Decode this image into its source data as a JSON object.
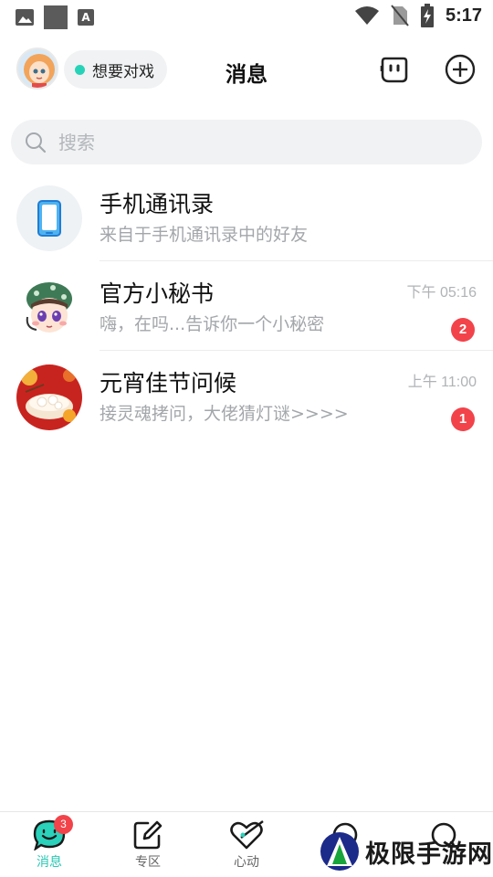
{
  "status_bar": {
    "time": "5:17"
  },
  "header": {
    "status_text": "想要对戏",
    "title": "消息",
    "colors": {
      "status_dot": "#27d3b8"
    }
  },
  "search": {
    "placeholder": "搜索"
  },
  "conversations": [
    {
      "name": "手机通讯录",
      "subtitle": "来自于手机通讯录中的好友",
      "time": "",
      "badge": ""
    },
    {
      "name": "官方小秘书",
      "subtitle": "嗨，在吗...告诉你一个小秘密",
      "time": "下午 05:16",
      "badge": "2"
    },
    {
      "name": "元宵佳节问候",
      "subtitle": "接灵魂拷问，大佬猜灯谜>>>>",
      "time": "上午 11:00",
      "badge": "1"
    }
  ],
  "bottom_nav": {
    "items": [
      {
        "label": "消息",
        "badge": "3",
        "active": true,
        "icon": "chat-bubble-icon"
      },
      {
        "label": "专区",
        "icon": "edit-square-icon"
      },
      {
        "label": "心动",
        "icon": "heart-arrow-icon"
      },
      {
        "label": "",
        "icon": "planet-icon"
      },
      {
        "label": "",
        "icon": "face-icon"
      }
    ]
  },
  "watermark": {
    "text": "极限手游网"
  },
  "colors": {
    "accent": "#29c7b4",
    "badge": "#f2434a"
  }
}
